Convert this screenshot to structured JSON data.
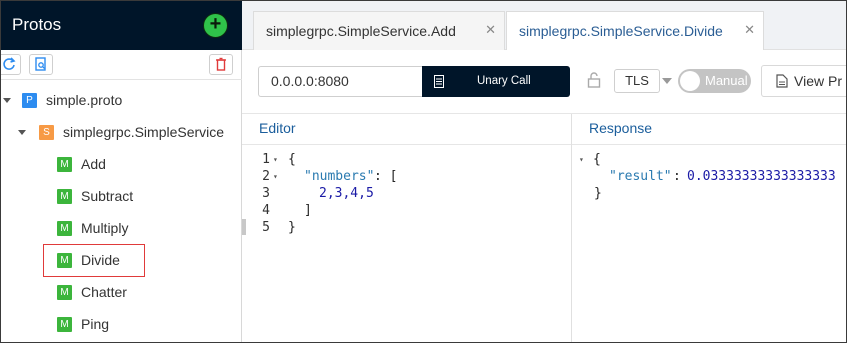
{
  "sidebar": {
    "title": "Protos",
    "tree": {
      "proto_file": {
        "badge": "P",
        "label": "simple.proto"
      },
      "service": {
        "badge": "S",
        "label": "simplegrpc.SimpleService"
      },
      "methods": [
        {
          "badge": "M",
          "label": "Add"
        },
        {
          "badge": "M",
          "label": "Subtract"
        },
        {
          "badge": "M",
          "label": "Multiply"
        },
        {
          "badge": "M",
          "label": "Divide",
          "selected": true
        },
        {
          "badge": "M",
          "label": "Chatter"
        },
        {
          "badge": "M",
          "label": "Ping"
        }
      ]
    }
  },
  "tabs": [
    {
      "label": "simplegrpc.SimpleService.Add",
      "active": false
    },
    {
      "label": "simplegrpc.SimpleService.Divide",
      "active": true
    }
  ],
  "request_bar": {
    "address": "0.0.0.0:8080",
    "call_type": "Unary Call",
    "tls_label": "TLS",
    "toggle_label": "Manual",
    "view_proto_label": "View Pr"
  },
  "editor": {
    "heading": "Editor",
    "lines": [
      {
        "num": "1",
        "text": "{"
      },
      {
        "num": "2",
        "key": "\"numbers\"",
        "rest": ": ["
      },
      {
        "num": "3",
        "text": "2,3,4,5"
      },
      {
        "num": "4",
        "text": "]"
      },
      {
        "num": "5",
        "text": "}"
      }
    ]
  },
  "response": {
    "heading": "Response",
    "open_brace": "{",
    "key": "\"result\"",
    "value": "0.03333333333333333",
    "close_brace": "}"
  },
  "colors": {
    "sidebar_header": "#001529",
    "add_button": "#2fc24a",
    "method_badge": "#3cb53c",
    "service_badge": "#f79a45",
    "proto_badge": "#2d8cf0",
    "active_tab_text": "#2a5d94",
    "selection_outline": "#e03a3a"
  }
}
